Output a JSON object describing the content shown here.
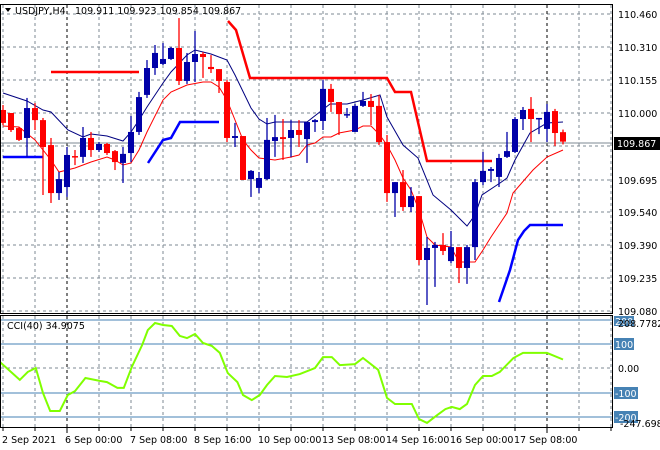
{
  "header": {
    "symbol_timeframe": "USDJPY,H4",
    "ohlc": "109.911 109.923 109.854 109.867"
  },
  "price_axis": {
    "labels": [
      "110.460",
      "110.310",
      "110.155",
      "110.000",
      "109.695",
      "109.540",
      "109.390",
      "109.235",
      "109.080"
    ],
    "current_price": "109.867"
  },
  "cci_panel": {
    "title": "CCI(40) 34.9075",
    "max_label": "208.7782",
    "min_label": "-247.6987",
    "level_200": "200",
    "level_100": "100",
    "zero_label": "0.00",
    "level_m100": "-100",
    "level_m200": "-200"
  },
  "time_axis": {
    "labels": [
      "2 Sep 2021",
      "6 Sep 00:00",
      "7 Sep 08:00",
      "8 Sep 16:00",
      "10 Sep 00:00",
      "13 Sep 08:00",
      "14 Sep 16:00",
      "16 Sep 00:00",
      "17 Sep 08:00"
    ]
  },
  "colors": {
    "bull": "#0000a8",
    "bear": "#ff0000",
    "ma_fast": "#000080",
    "ma_slow": "#ff0000",
    "cci": "#80ff00",
    "levels": "#4682b4"
  },
  "chart_data": [
    {
      "type": "candlestick",
      "title": "USDJPY,H4",
      "ylim": [
        109.08,
        110.46
      ],
      "candles_ohlc": [
        [
          110.014,
          110.037,
          109.944,
          109.954
        ],
        [
          110.0,
          110.0,
          109.912,
          109.921
        ],
        [
          109.93,
          109.935,
          109.87,
          109.875
        ],
        [
          109.884,
          110.07,
          109.796,
          110.023
        ],
        [
          110.023,
          110.046,
          109.921,
          109.967
        ],
        [
          109.967,
          109.977,
          109.619,
          109.842
        ],
        [
          109.851,
          109.884,
          109.582,
          109.628
        ],
        [
          109.628,
          109.726,
          109.596,
          109.693
        ],
        [
          109.656,
          109.842,
          109.61,
          109.805
        ],
        [
          109.8,
          109.828,
          109.758,
          109.796
        ],
        [
          109.796,
          109.935,
          109.768,
          109.884
        ],
        [
          109.884,
          109.912,
          109.796,
          109.828
        ],
        [
          109.828,
          109.865,
          109.819,
          109.856
        ],
        [
          109.856,
          109.861,
          109.805,
          109.814
        ],
        [
          109.823,
          109.828,
          109.735,
          109.772
        ],
        [
          109.768,
          109.842,
          109.675,
          109.81
        ],
        [
          109.814,
          109.986,
          109.772,
          109.912
        ],
        [
          109.912,
          110.098,
          109.898,
          110.074
        ],
        [
          110.084,
          110.246,
          110.07,
          110.209
        ],
        [
          110.209,
          110.316,
          110.177,
          110.279
        ],
        [
          110.228,
          110.325,
          110.223,
          110.251
        ],
        [
          110.251,
          110.307,
          110.246,
          110.302
        ],
        [
          110.302,
          110.441,
          110.13,
          110.149
        ],
        [
          110.149,
          110.279,
          110.135,
          110.237
        ],
        [
          110.237,
          110.381,
          110.144,
          110.274
        ],
        [
          110.274,
          110.283,
          110.163,
          110.26
        ],
        [
          110.214,
          110.269,
          110.186,
          110.204
        ],
        [
          110.204,
          110.204,
          110.093,
          110.149
        ],
        [
          110.144,
          110.153,
          109.865,
          109.884
        ],
        [
          109.884,
          109.954,
          109.842,
          109.893
        ],
        [
          109.893,
          109.893,
          109.689,
          109.689
        ],
        [
          109.693,
          109.735,
          109.61,
          109.731
        ],
        [
          109.652,
          109.726,
          109.628,
          109.698
        ],
        [
          109.693,
          109.977,
          109.689,
          109.875
        ],
        [
          109.87,
          109.991,
          109.796,
          109.888
        ],
        [
          109.888,
          109.972,
          109.782,
          109.879
        ],
        [
          109.884,
          109.967,
          109.796,
          109.921
        ],
        [
          109.921,
          109.967,
          109.842,
          109.898
        ],
        [
          109.879,
          109.958,
          109.768,
          109.958
        ],
        [
          109.958,
          109.972,
          109.912,
          109.967
        ],
        [
          109.963,
          110.153,
          109.921,
          110.112
        ],
        [
          110.112,
          110.135,
          110.005,
          110.051
        ],
        [
          110.051,
          110.051,
          109.898,
          109.995
        ],
        [
          109.991,
          110.023,
          109.977,
          109.995
        ],
        [
          109.912,
          110.042,
          109.912,
          110.033
        ],
        [
          110.033,
          110.098,
          110.028,
          110.056
        ],
        [
          110.056,
          110.088,
          109.944,
          110.028
        ],
        [
          110.033,
          110.084,
          109.851,
          109.865
        ],
        [
          109.865,
          109.898,
          109.587,
          109.628
        ],
        [
          109.628,
          109.679,
          109.517,
          109.679
        ],
        [
          109.679,
          109.735,
          109.545,
          109.563
        ],
        [
          109.563,
          109.656,
          109.54,
          109.614
        ],
        [
          109.614,
          109.614,
          109.294,
          109.317
        ],
        [
          109.317,
          109.424,
          109.108,
          109.373
        ],
        [
          109.373,
          109.401,
          109.192,
          109.387
        ],
        [
          109.387,
          109.442,
          109.34,
          109.359
        ],
        [
          109.312,
          109.452,
          109.303,
          109.377
        ],
        [
          109.377,
          109.377,
          109.21,
          109.28
        ],
        [
          109.28,
          109.387,
          109.206,
          109.377
        ],
        [
          109.377,
          109.693,
          109.317,
          109.679
        ],
        [
          109.679,
          109.819,
          109.665,
          109.731
        ],
        [
          109.731,
          109.749,
          109.679,
          109.74
        ],
        [
          109.703,
          109.81,
          109.656,
          109.791
        ],
        [
          109.796,
          109.912,
          109.791,
          109.823
        ],
        [
          109.819,
          109.981,
          109.814,
          109.972
        ],
        [
          109.972,
          110.028,
          109.921,
          110.014
        ],
        [
          110.019,
          110.074,
          109.865,
          109.972
        ],
        [
          109.972,
          109.977,
          109.902,
          109.977
        ],
        [
          109.926,
          110.042,
          109.865,
          110.005
        ],
        [
          110.009,
          110.019,
          109.847,
          109.907
        ],
        [
          109.911,
          109.923,
          109.854,
          109.867
        ]
      ]
    },
    {
      "type": "line",
      "title": "CCI(40)",
      "ylim": [
        -247.6987,
        208.7782
      ],
      "levels": [
        200,
        100,
        -100,
        -200
      ],
      "points_bar_value": [
        [
          -0.4,
          25
        ],
        [
          2.1,
          -49
        ],
        [
          3.1,
          -16
        ],
        [
          4.1,
          0
        ],
        [
          5,
          -103
        ],
        [
          5.9,
          -177
        ],
        [
          7.1,
          -177
        ],
        [
          8.1,
          -111
        ],
        [
          9,
          -95
        ],
        [
          10.3,
          -41
        ],
        [
          12.1,
          -53
        ],
        [
          13,
          -58
        ],
        [
          14.3,
          -82
        ],
        [
          15.1,
          -82
        ],
        [
          16.1,
          4
        ],
        [
          17.4,
          95
        ],
        [
          18.1,
          156
        ],
        [
          19,
          185
        ],
        [
          20,
          177
        ],
        [
          21.1,
          173
        ],
        [
          22.1,
          132
        ],
        [
          23,
          123
        ],
        [
          24,
          140
        ],
        [
          25,
          103
        ],
        [
          26.1,
          91
        ],
        [
          27.1,
          62
        ],
        [
          28.1,
          -21
        ],
        [
          29.3,
          -58
        ],
        [
          30,
          -111
        ],
        [
          31.1,
          -132
        ],
        [
          32.1,
          -111
        ],
        [
          33,
          -70
        ],
        [
          34,
          -33
        ],
        [
          35.5,
          -37
        ],
        [
          37.1,
          -25
        ],
        [
          39,
          0
        ],
        [
          40,
          45
        ],
        [
          41.1,
          45
        ],
        [
          42.1,
          12
        ],
        [
          44,
          16
        ],
        [
          45,
          41
        ],
        [
          46.9,
          -8
        ],
        [
          48,
          -123
        ],
        [
          49,
          -148
        ],
        [
          51.1,
          -148
        ],
        [
          52,
          -210
        ],
        [
          53,
          -226
        ],
        [
          54.3,
          -193
        ],
        [
          55.3,
          -169
        ],
        [
          56.1,
          -160
        ],
        [
          57.1,
          -169
        ],
        [
          58,
          -148
        ],
        [
          59,
          -70
        ],
        [
          60,
          -33
        ],
        [
          61.1,
          -33
        ],
        [
          62.1,
          -16
        ],
        [
          63.8,
          41
        ],
        [
          65,
          62
        ],
        [
          68,
          62
        ],
        [
          70,
          34.9075
        ]
      ]
    }
  ]
}
